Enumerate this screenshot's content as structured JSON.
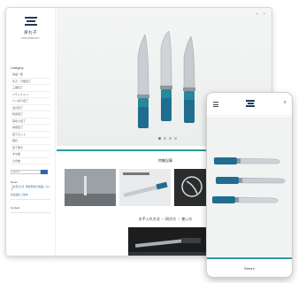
{
  "brand": {
    "logo_text": "楽丸子",
    "logo_sub": "RAKUMARUKO"
  },
  "sidebar": {
    "category_title": "Category",
    "items": [
      "商品一覧",
      "牛刀・万能包丁",
      "三徳包丁",
      "ペティナイフ",
      "パン切り包丁",
      "出刃包丁",
      "刺身包丁",
      "菜切り包丁",
      "中華包丁",
      "包丁セット",
      "砥石",
      "包丁研ぎ",
      "まな板",
      "その他"
    ],
    "search_placeholder": "Search",
    "info_title": "News",
    "info_links": [
      "【お知らせ】年末年始の営業について",
      "新商品のご案内"
    ],
    "contact_title": "Contact"
  },
  "hero": {
    "controls": "<  >"
  },
  "sections": {
    "feature_title": "特集記事",
    "feature_tiles": [
      "包丁の選び方",
      "砥石について",
      "お手入れ"
    ],
    "howto_title": "お手入れ方法 ・ 研ぎ方 ・ 使い方",
    "howto_tiles": [
      "研ぎ方ガイド"
    ]
  },
  "phone": {
    "footer_label": "Return"
  },
  "colors": {
    "accent": "#2b9aa0",
    "brand": "#1f3d5c",
    "handle": "#1f6e8f"
  },
  "icons": {
    "menu": "hamburger-icon",
    "search": "search-icon"
  }
}
